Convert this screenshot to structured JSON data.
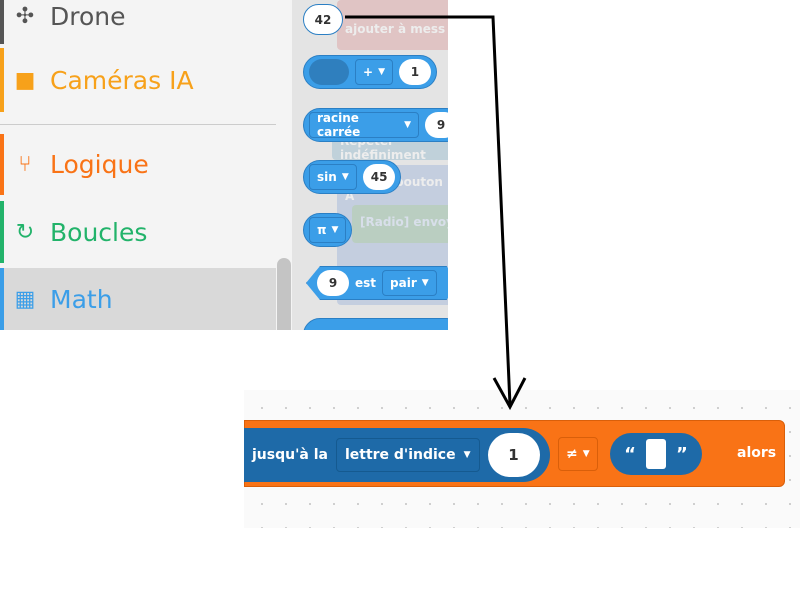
{
  "sidebar": {
    "categories": [
      {
        "label": "Drone",
        "icon": "drone-icon",
        "color": "#555555"
      },
      {
        "label": "Caméras IA",
        "icon": "camera-icon",
        "color": "#f7a11a"
      },
      {
        "label": "Logique",
        "icon": "branch-icon",
        "color": "#f97316"
      },
      {
        "label": "Boucles",
        "icon": "refresh-icon",
        "color": "#22b36a"
      },
      {
        "label": "Math",
        "icon": "calculator-icon",
        "color": "#3b9ee8",
        "selected": true
      }
    ]
  },
  "flyout": {
    "ghost": [
      "ajouter à",
      "mess",
      "Répéter indéfiniment",
      "bouton",
      "A",
      "[Radio] envoy"
    ],
    "number": "42",
    "arith": {
      "op": "+",
      "value": "1"
    },
    "sqrt": {
      "op": "racine carrée",
      "value": "9"
    },
    "trig": {
      "op": "sin",
      "value": "45"
    },
    "const": {
      "op": "π"
    },
    "parity": {
      "value": "9",
      "word": "est",
      "op": "pair"
    }
  },
  "workspace": {
    "prefix": "jusqu'à la",
    "dropdown": "lettre d'indice",
    "index": "1",
    "compare": "≠",
    "quote_open": "“",
    "quote_close": "”",
    "suffix": "alors"
  }
}
